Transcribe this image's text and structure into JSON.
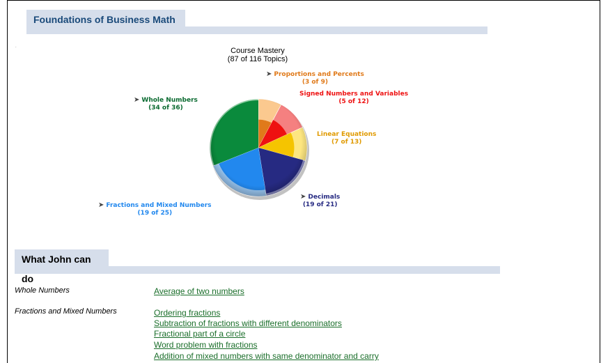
{
  "course": {
    "title": "Foundations of Business Math",
    "dot": "."
  },
  "chart_data": {
    "type": "pie",
    "title": "Course Mastery",
    "subtitle": "(87 of 116 Topics)",
    "slices": [
      {
        "name": "Proportions and Percents",
        "mastered": 3,
        "total": 9,
        "count_label": "(3 of 9)",
        "color": "#e07a1a",
        "light": "#fbc98f",
        "label_color": "#e07a1a"
      },
      {
        "name": "Signed Numbers and Variables",
        "mastered": 5,
        "total": 12,
        "count_label": "(5 of 12)",
        "color": "#ee1111",
        "light": "#f58080",
        "label_color": "#ee1111"
      },
      {
        "name": "Linear Equations",
        "mastered": 7,
        "total": 13,
        "count_label": "(7 of 13)",
        "color": "#f5c400",
        "light": "#fde680",
        "label_color": "#e09a00"
      },
      {
        "name": "Decimals",
        "mastered": 19,
        "total": 21,
        "count_label": "(19 of 21)",
        "color": "#262a82",
        "light": "#8e90c8",
        "label_color": "#262a82"
      },
      {
        "name": "Fractions and Mixed Numbers",
        "mastered": 19,
        "total": 25,
        "count_label": "(19 of 25)",
        "color": "#2288ee",
        "light": "#9ccaf6",
        "label_color": "#2288ee"
      },
      {
        "name": "Whole Numbers",
        "mastered": 34,
        "total": 36,
        "count_label": "(34 of 36)",
        "color": "#0a8a3c",
        "light": "#8ccfa2",
        "label_color": "#0a6a30"
      }
    ]
  },
  "can_do": {
    "heading": "What John can do",
    "groups": [
      {
        "category": "Whole Numbers",
        "items": [
          "Average of two numbers"
        ]
      },
      {
        "category": "Fractions and Mixed Numbers",
        "items": [
          "Ordering fractions",
          "Subtraction of fractions with different denominators",
          "Fractional part of a circle",
          "Word problem with fractions",
          "Addition of mixed numbers with same denominator and carry"
        ]
      }
    ]
  }
}
